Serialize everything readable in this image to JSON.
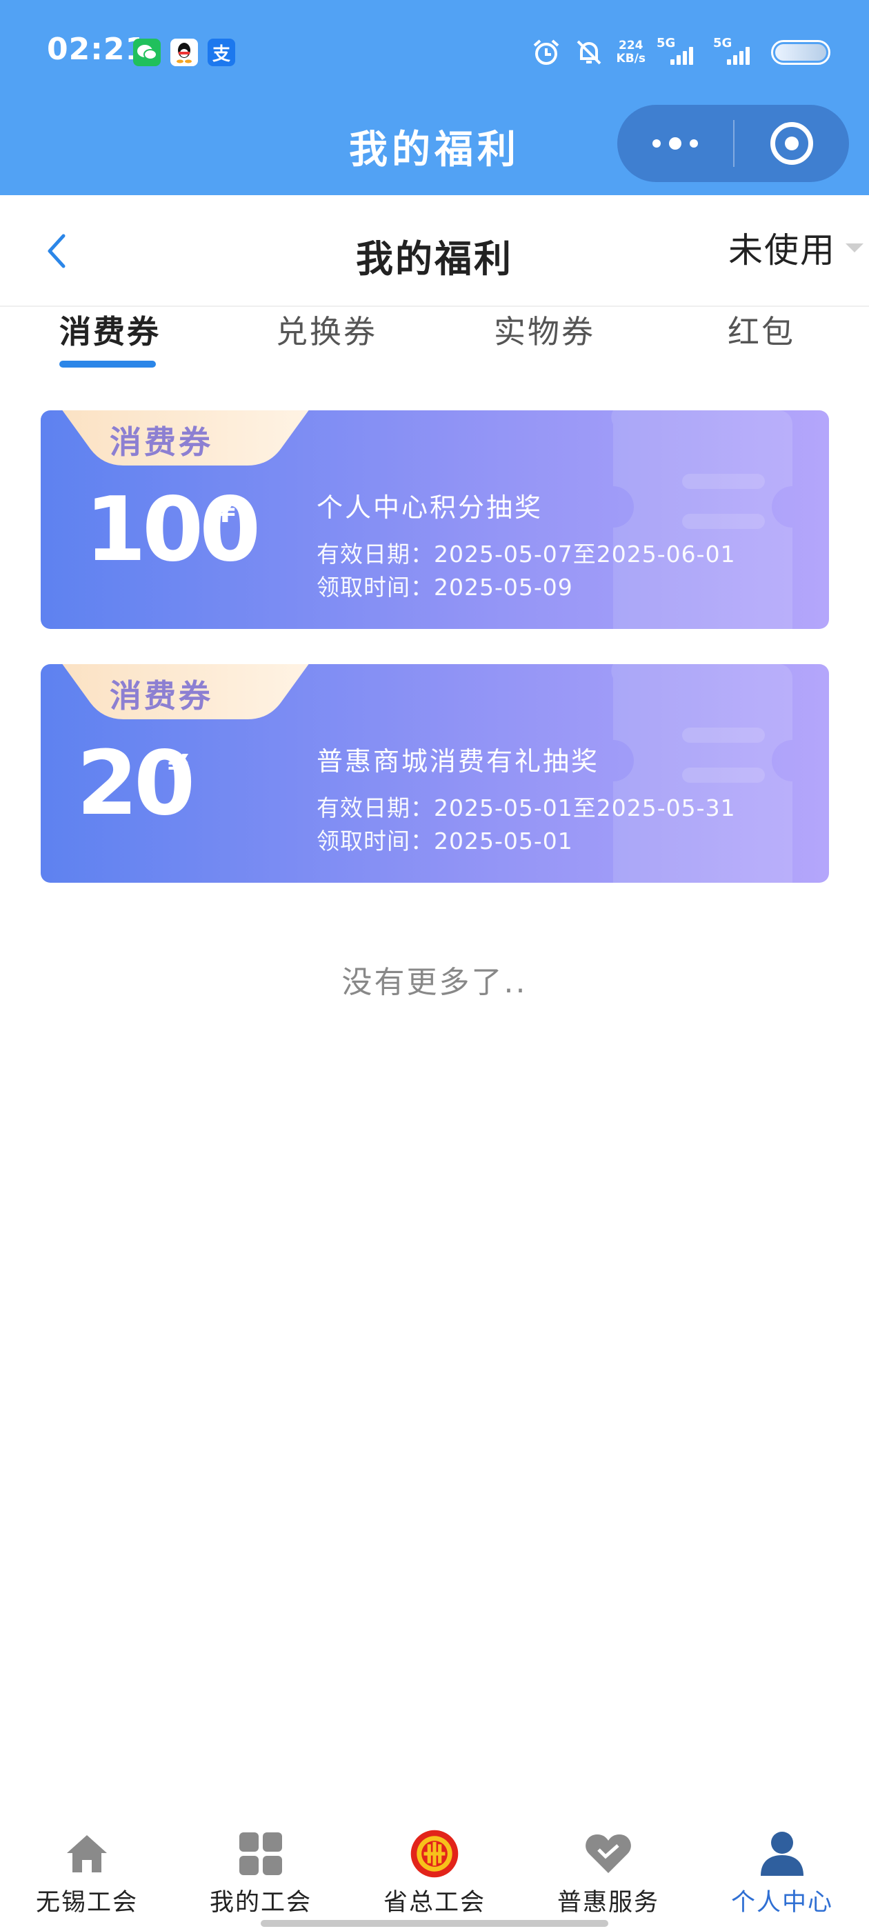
{
  "status_bar": {
    "time": "02:21",
    "apps": [
      {
        "icon": "wechat-icon",
        "glyph": ""
      },
      {
        "icon": "qq-icon",
        "glyph": ""
      },
      {
        "icon": "alipay-icon",
        "glyph": "支"
      }
    ],
    "net_speed_value": "224",
    "net_speed_unit": "KB/s",
    "sim1_label": "5G",
    "sim2_label": "5G"
  },
  "mini_program": {
    "title": "我的福利"
  },
  "header": {
    "title": "我的福利",
    "filter_label": "未使用"
  },
  "tabs": [
    {
      "label": "消费券",
      "active": true
    },
    {
      "label": "兑换券",
      "active": false
    },
    {
      "label": "实物券",
      "active": false
    },
    {
      "label": "红包",
      "active": false
    }
  ],
  "coupons": [
    {
      "tag": "消费券",
      "amount": "100",
      "currency": "¥",
      "name": "个人中心积分抽奖",
      "validity": "有效日期：2025-05-07至2025-06-01",
      "received": "领取时间：2025-05-09"
    },
    {
      "tag": "消费券",
      "amount": "20",
      "currency": "¥",
      "name": "普惠商城消费有礼抽奖",
      "validity": "有效日期：2025-05-01至2025-05-31",
      "received": "领取时间：2025-05-01"
    }
  ],
  "list_end_text": "没有更多了..",
  "bottom_nav": [
    {
      "label": "无锡工会",
      "icon": "home-icon",
      "active": false
    },
    {
      "label": "我的工会",
      "icon": "grid-icon",
      "active": false
    },
    {
      "label": "省总工会",
      "icon": "union-emblem-icon",
      "active": false
    },
    {
      "label": "普惠服务",
      "icon": "heart-icon",
      "active": false
    },
    {
      "label": "个人中心",
      "icon": "person-icon",
      "active": true
    }
  ],
  "colors": {
    "primary_blue": "#52a2f4",
    "tab_underline": "#2b86e8",
    "active_nav": "#2f6fd3",
    "coupon_gradient_start": "#5e82f0",
    "coupon_gradient_end": "#b4a6fb",
    "tag_text": "#8c7fd2"
  }
}
